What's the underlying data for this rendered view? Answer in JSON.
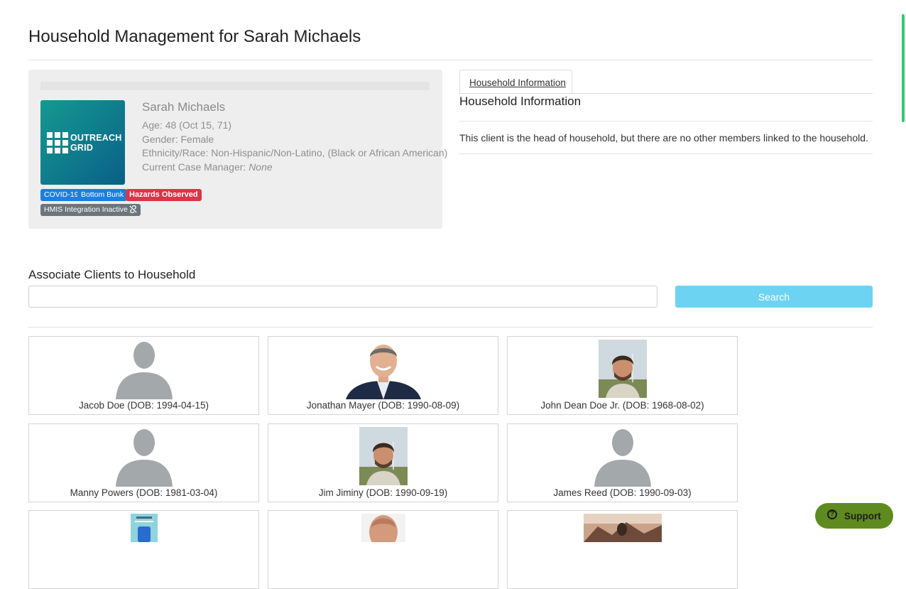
{
  "page": {
    "title": "Household Management for Sarah Michaels"
  },
  "client": {
    "logo_line1": "OUTREACH",
    "logo_line2": "GRID",
    "name": "Sarah Michaels",
    "age_label": "Age:",
    "age_value": "48 (Oct 15, 71)",
    "gender_label": "Gender:",
    "gender_value": "Female",
    "ethnicity_label": "Ethnicity/Race:",
    "ethnicity_value": "Non-Hispanic/Non-Latino, (Black or African American)",
    "case_manager_label": "Current Case Manager:",
    "case_manager_value": "None",
    "badges": [
      {
        "label": "COVID-19",
        "color": "#1a7fe0"
      },
      {
        "label": "Bottom Bunk",
        "color": "#1a7fe0"
      },
      {
        "label": "Hazards Observed",
        "color": "#dc3545"
      },
      {
        "label": "HMIS Integration Inactive",
        "color": "#6c757d",
        "icon": "unlink-icon"
      }
    ]
  },
  "household": {
    "tab_label": "Household Information",
    "title": "Household Information",
    "message": "This client is the head of household, but there are no other members linked to the household."
  },
  "associate": {
    "title": "Associate Clients to Household",
    "search_placeholder": "",
    "search_button": "Search"
  },
  "clients": [
    {
      "label": "Jacob Doe (DOB: 1994-04-15)",
      "photo": "silhouette"
    },
    {
      "label": "Jonathan Mayer (DOB: 1990-08-09)",
      "photo": "man-suit"
    },
    {
      "label": "John Dean Doe Jr. (DOB: 1968-08-02)",
      "photo": "young-man"
    },
    {
      "label": "Manny Powers (DOB: 1981-03-04)",
      "photo": "silhouette"
    },
    {
      "label": "Jim Jiminy (DOB: 1990-09-19)",
      "photo": "young-man"
    },
    {
      "label": "James Reed (DOB: 1990-09-03)",
      "photo": "silhouette"
    },
    {
      "label": "",
      "photo": "phone-screen"
    },
    {
      "label": "",
      "photo": "bald-man"
    },
    {
      "label": "",
      "photo": "landscape"
    }
  ],
  "support": {
    "label": "Support"
  },
  "colors": {
    "accent_blue": "#1a7fe0",
    "danger_red": "#dc3545",
    "search_button": "#6dd3f3",
    "support_green": "#5f8a1f",
    "logo_teal": "#139a90"
  }
}
